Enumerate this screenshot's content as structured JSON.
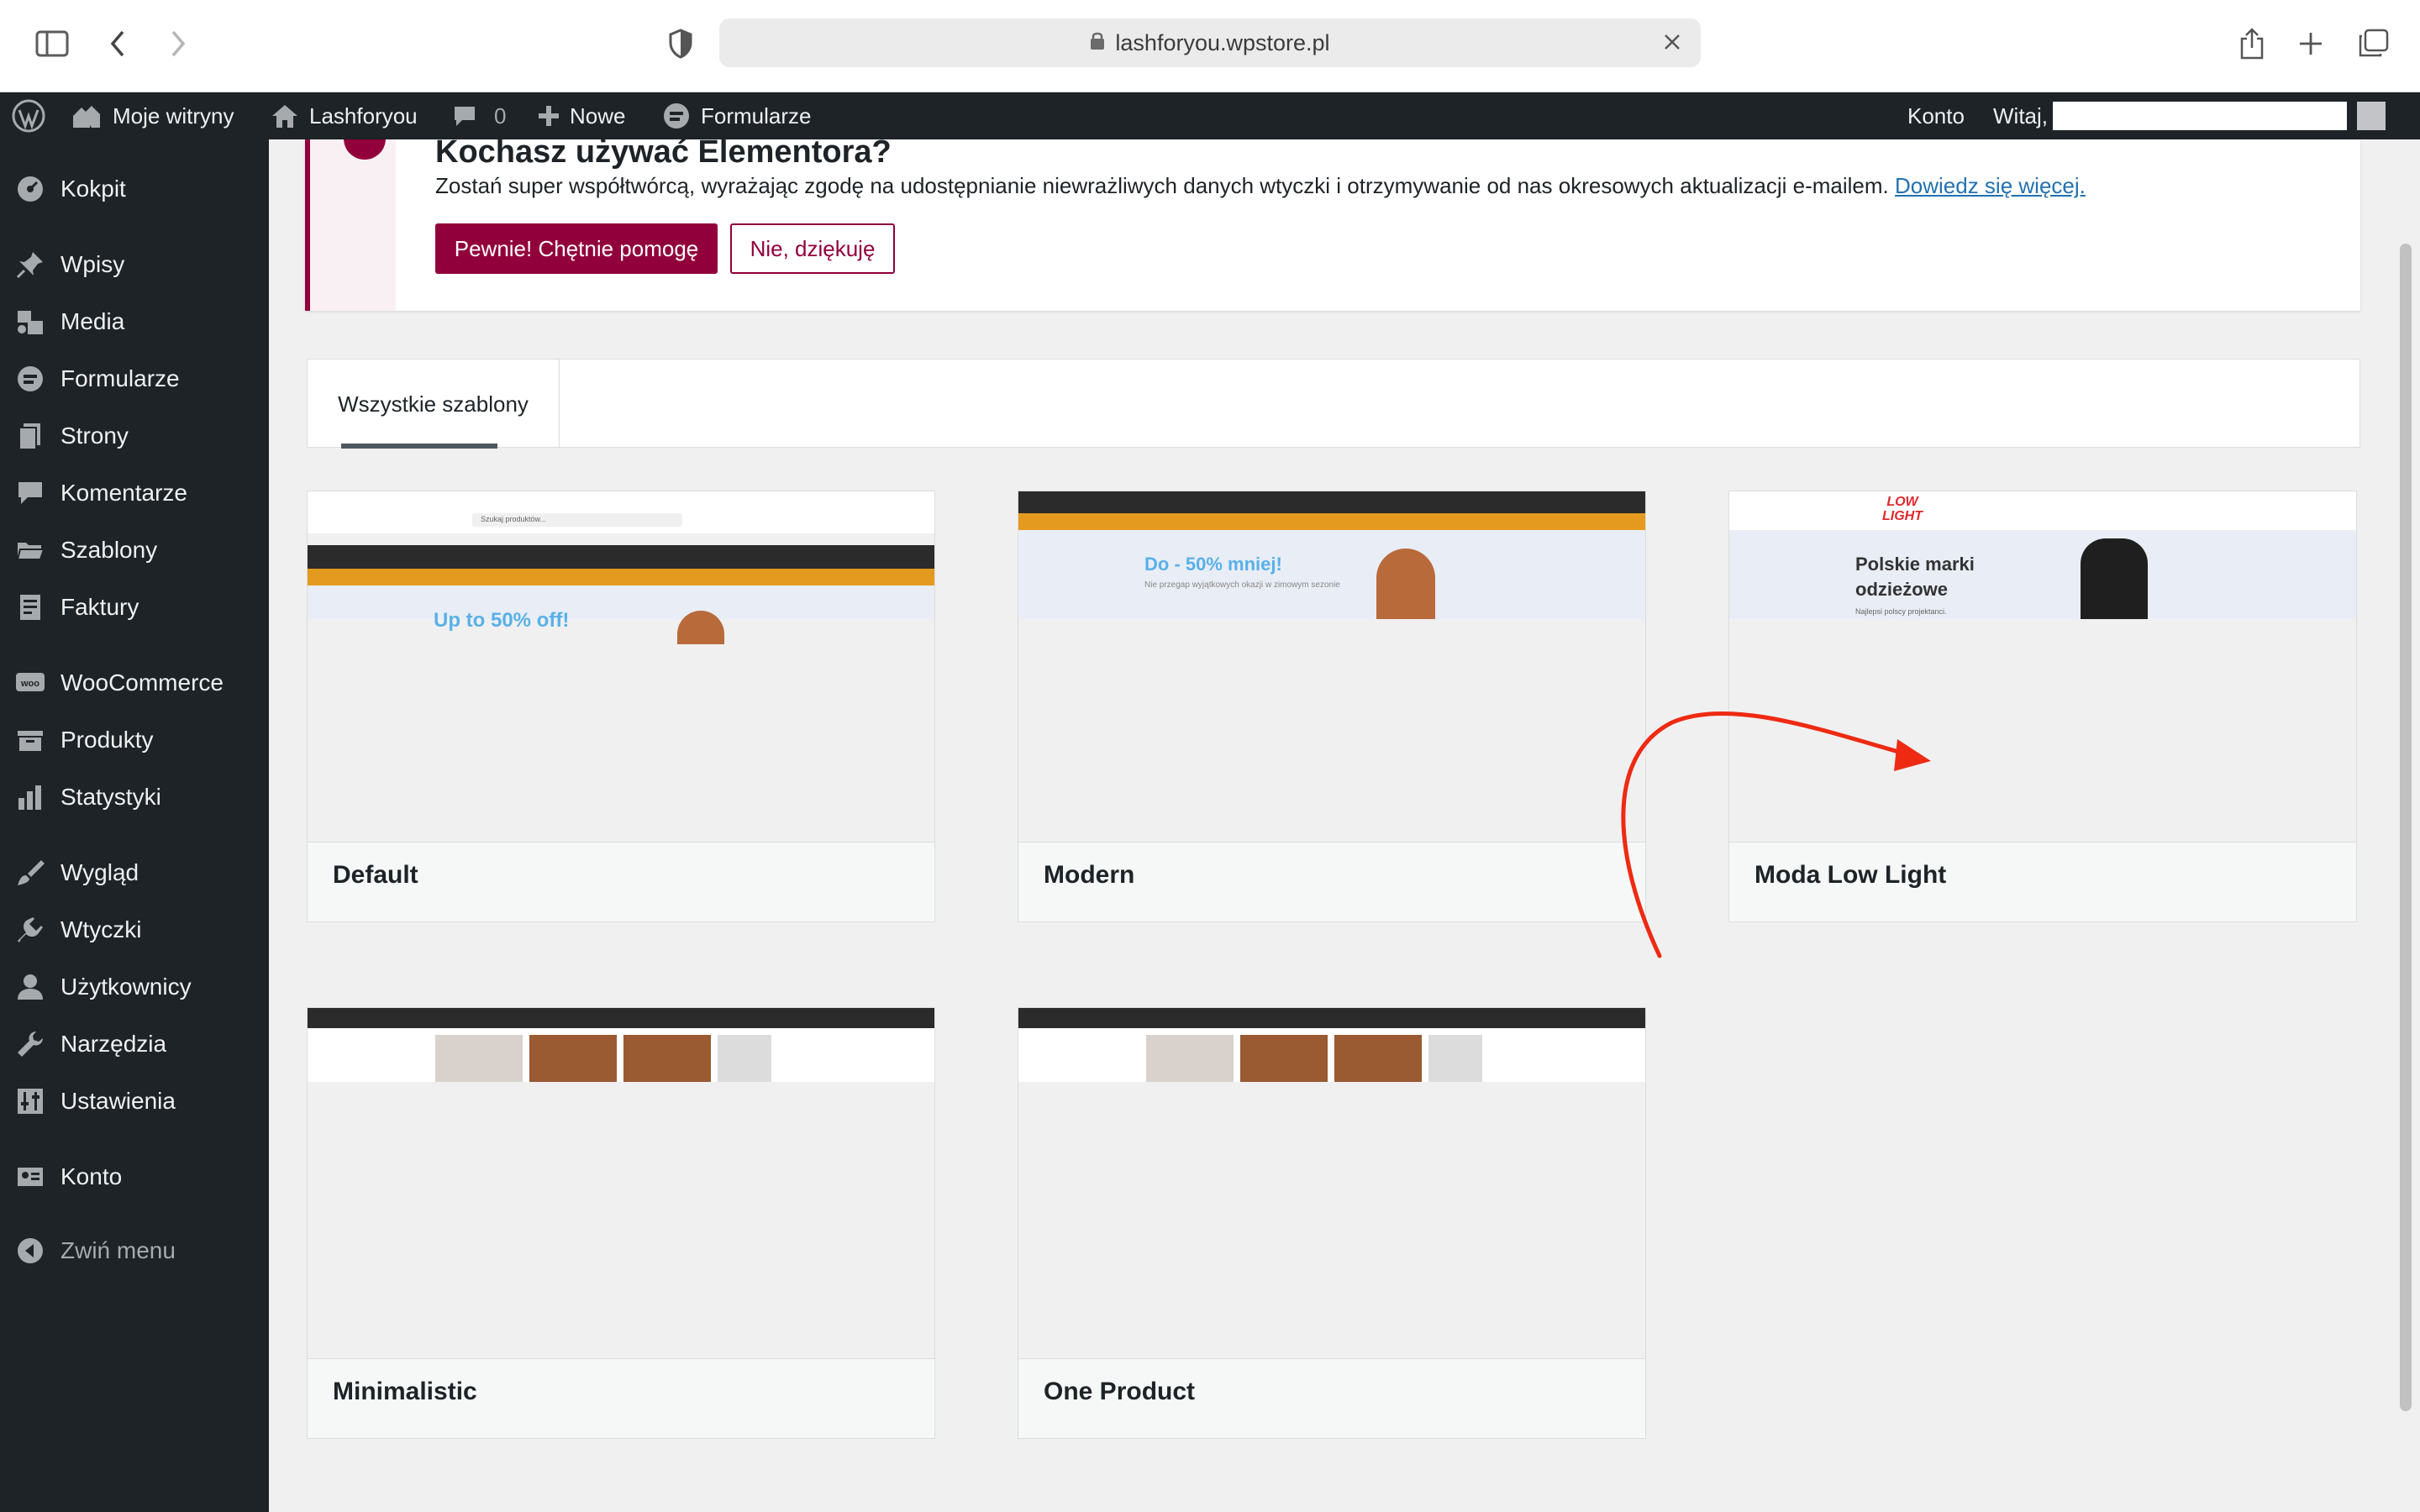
{
  "browser": {
    "url": "lashforyou.wpstore.pl"
  },
  "adminbar": {
    "sites": "Moje witryny",
    "site": "Lashforyou",
    "comments": "0",
    "new": "Nowe",
    "forms": "Formularze",
    "account": "Konto",
    "greeting": "Witaj,"
  },
  "sidebar": {
    "items": [
      {
        "label": "Kokpit"
      },
      {
        "label": "Wpisy"
      },
      {
        "label": "Media"
      },
      {
        "label": "Formularze"
      },
      {
        "label": "Strony"
      },
      {
        "label": "Komentarze"
      },
      {
        "label": "Szablony"
      },
      {
        "label": "Faktury"
      },
      {
        "label": "WooCommerce"
      },
      {
        "label": "Produkty"
      },
      {
        "label": "Statystyki"
      },
      {
        "label": "Wygląd"
      },
      {
        "label": "Wtyczki"
      },
      {
        "label": "Użytkownicy"
      },
      {
        "label": "Narzędzia"
      },
      {
        "label": "Ustawienia"
      },
      {
        "label": "Konto"
      },
      {
        "label": "Zwiń menu"
      }
    ]
  },
  "notice": {
    "title": "Kochasz używać Elementora?",
    "text": "Zostań super współtwórcą, wyrażając zgodę na udostępnianie niewrażliwych danych wtyczki i otrzymywanie od nas okresowych aktualizacji e-mailem.",
    "link": "Dowiedz się więcej.",
    "accept": "Pewnie! Chętnie pomogę",
    "decline": "Nie, dziękuję"
  },
  "tabs": {
    "all": "Wszystkie szablony"
  },
  "templates": [
    {
      "name": "Default",
      "banner": "Up to 50% off!",
      "search": "Szukaj produktów..."
    },
    {
      "name": "Modern",
      "banner": "Do - 50% mniej!",
      "sub": "Nie przegap wyjątkowych okazji w zimowym sezonie"
    },
    {
      "name": "Moda Low Light",
      "logo": "LOW LIGHT",
      "headline": "Polskie marki odzieżowe",
      "sub": "Najlepsi polscy projektanci."
    },
    {
      "name": "Minimalistic"
    },
    {
      "name": "One Product"
    }
  ],
  "colors": {
    "admin_dark": "#1d2327",
    "elementor": "#92003b",
    "link": "#2271b1",
    "annotation": "#ee2a13"
  }
}
